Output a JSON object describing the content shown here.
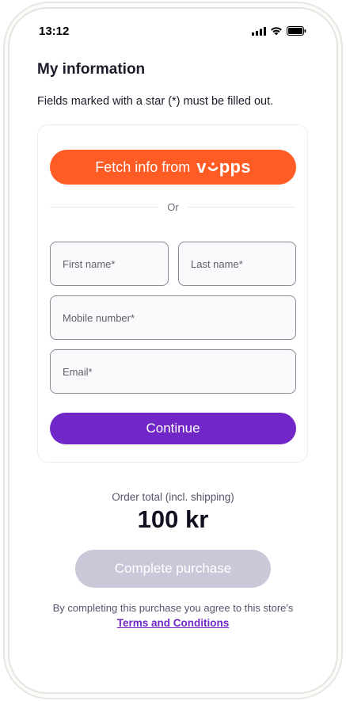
{
  "status_bar": {
    "time": "13:12"
  },
  "page": {
    "title": "My information",
    "instructions": "Fields marked with a star (*) must be filled out."
  },
  "vipps": {
    "label": "Fetch info from",
    "brand_left": "v",
    "brand_right": "pps",
    "color": "#ff5b24"
  },
  "divider": {
    "label": "Or"
  },
  "form": {
    "first_name_placeholder": "First name*",
    "last_name_placeholder": "Last name*",
    "mobile_placeholder": "Mobile number*",
    "email_placeholder": "Email*"
  },
  "continue_button": {
    "label": "Continue",
    "color": "#7127c8"
  },
  "order": {
    "label": "Order total (incl. shipping)",
    "total": "100 kr"
  },
  "complete_button": {
    "label": "Complete purchase",
    "color": "#c9c8d8"
  },
  "terms": {
    "text": "By completing this purchase you agree to this store's",
    "link_label": "Terms and Conditions"
  },
  "icons": [
    "signal-icon",
    "wifi-icon",
    "battery-icon"
  ]
}
